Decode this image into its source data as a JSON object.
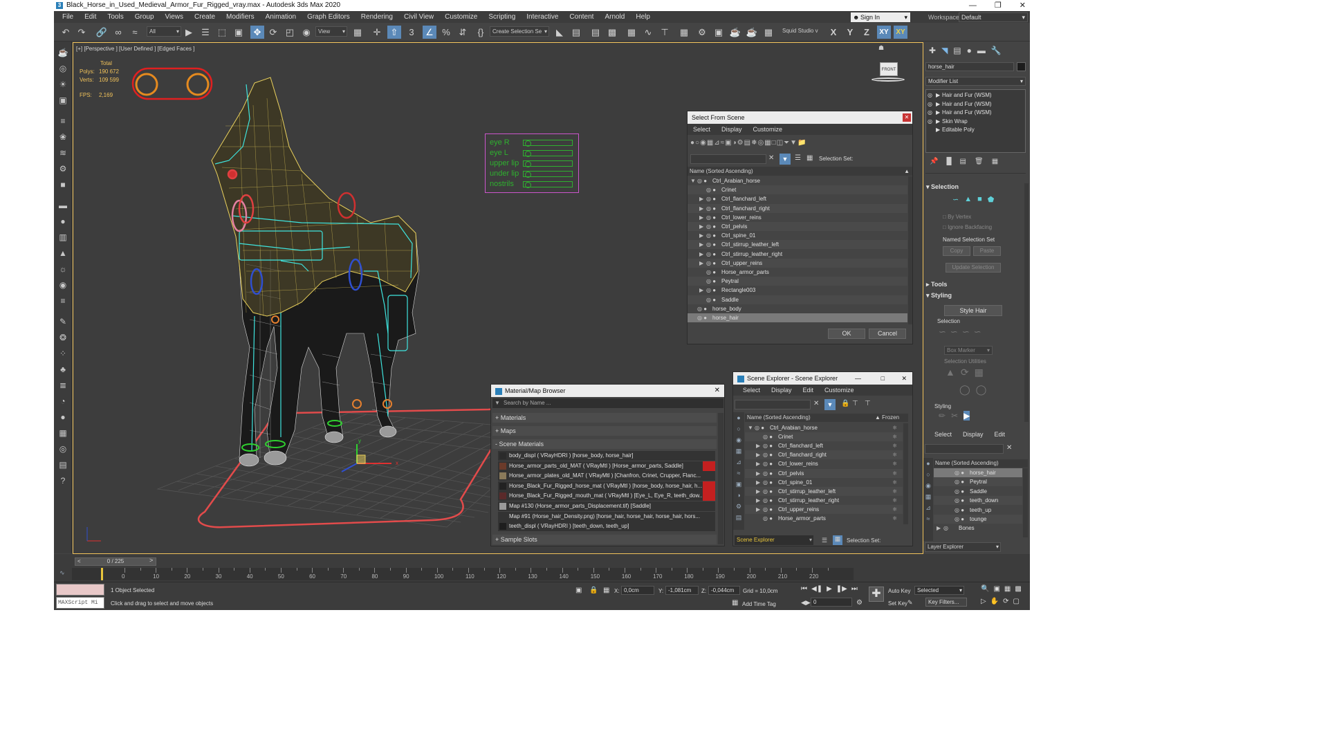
{
  "title": "Black_Horse_in_Used_Medieval_Armor_Fur_Rigged_vray.max - Autodesk 3ds Max 2020",
  "menu": [
    "File",
    "Edit",
    "Tools",
    "Group",
    "Views",
    "Create",
    "Modifiers",
    "Animation",
    "Graph Editors",
    "Rendering",
    "Civil View",
    "Customize",
    "Scripting",
    "Interactive",
    "Content",
    "Arnold",
    "Help"
  ],
  "signin": "Sign In",
  "workspace": {
    "label": "Workspaces:",
    "value": "Default"
  },
  "toolbar": {
    "filter": "All",
    "view": "View",
    "selection_set": "Create Selection Se",
    "squid": "Squid Studio v",
    "axes": [
      "X",
      "Y",
      "Z",
      "XY",
      "XY"
    ],
    "snap3": "3",
    "percent": "%"
  },
  "viewport": {
    "label": "[+] [Perspective ] [User Defined ] [Edged Faces ]",
    "stats": {
      "header": "Total",
      "polys_label": "Polys:",
      "polys": "190 672",
      "verts_label": "Verts:",
      "verts": "109 599",
      "fps_label": "FPS:",
      "fps": "2,169"
    },
    "rig_controls": [
      "eye R",
      "eye L",
      "upper lip",
      "under lip",
      "nostrils"
    ],
    "viewcube": "FRONT",
    "gizmo_axes": [
      "x",
      "y",
      "z"
    ]
  },
  "select_from_scene": {
    "title": "Select From Scene",
    "menu": [
      "Select",
      "Display",
      "Customize"
    ],
    "selection_set_label": "Selection Set:",
    "column": "Name (Sorted Ascending)",
    "rows": [
      {
        "name": "Ctrl_Arabian_horse",
        "level": 0,
        "expanded": true
      },
      {
        "name": "Crinet",
        "level": 1,
        "expanded": false,
        "leaf": true
      },
      {
        "name": "Ctrl_flanchard_left",
        "level": 1
      },
      {
        "name": "Ctrl_flanchard_right",
        "level": 1
      },
      {
        "name": "Ctrl_lower_reins",
        "level": 1
      },
      {
        "name": "Ctrl_pelvis",
        "level": 1
      },
      {
        "name": "Ctrl_spine_01",
        "level": 1
      },
      {
        "name": "Ctrl_stirrup_leather_left",
        "level": 1
      },
      {
        "name": "Ctrl_stirrup_leather_right",
        "level": 1
      },
      {
        "name": "Ctrl_upper_reins",
        "level": 1
      },
      {
        "name": "Horse_armor_parts",
        "level": 1,
        "leaf": true
      },
      {
        "name": "Peytral",
        "level": 1,
        "leaf": true
      },
      {
        "name": "Rectangle003",
        "level": 1
      },
      {
        "name": "Saddle",
        "level": 1,
        "leaf": true
      },
      {
        "name": "horse_body",
        "level": 0,
        "leaf": true
      },
      {
        "name": "horse_hair",
        "level": 0,
        "leaf": true,
        "selected": true
      }
    ],
    "ok": "OK",
    "cancel": "Cancel"
  },
  "material_browser": {
    "title": "Material/Map Browser",
    "search_placeholder": "Search by Name ...",
    "sections": [
      "+ Materials",
      "+ Maps",
      "- Scene Materials",
      "+ Sample Slots"
    ],
    "materials": [
      {
        "text": "body_displ ( VRayHDRI ) [horse_body, horse_hair]",
        "swatch": "#2b2b2b"
      },
      {
        "text": "Horse_armor_parts_old_MAT ( VRayMtl ) [Horse_armor_parts, Saddle]",
        "swatch": "#6b3b2a"
      },
      {
        "text": "Horse_armor_plates_old_MAT ( VRayMtl ) [Chanfron, Crinet, Crupper, Flanc...",
        "swatch": "#8a7a5a"
      },
      {
        "text": "Horse_Black_Fur_Rigged_horse_mat ( VRayMtl ) [horse_body, horse_hair, h...",
        "swatch": "#222222"
      },
      {
        "text": "Horse_Black_Fur_Rigged_mouth_mat ( VRayMtl ) [Eye_L, Eye_R, teeth_dow...",
        "swatch": "#5a2a2a"
      },
      {
        "text": "Map #130 (Horse_armor_parts_Displacement.tif) [Saddle]",
        "swatch": "#9a9a9a"
      },
      {
        "text": "Map #91 (Horse_hair_Density.png) [horse_hair, horse_hair, horse_hair, hors...",
        "swatch": "#333333"
      },
      {
        "text": "teeth_displ ( VRayHDRI ) [teeth_down, teeth_up]",
        "swatch": "#1e1e1e"
      }
    ]
  },
  "scene_explorer": {
    "title": "Scene Explorer - Scene Explorer",
    "menu": [
      "Select",
      "Display",
      "Edit",
      "Customize"
    ],
    "column": "Name (Sorted Ascending)",
    "frozen": "▲ Frozen",
    "rows": [
      "Ctrl_Arabian_horse",
      "Crinet",
      "Ctrl_flanchard_left",
      "Ctrl_flanchard_right",
      "Ctrl_lower_reins",
      "Ctrl_pelvis",
      "Ctrl_spine_01",
      "Ctrl_stirrup_leather_left",
      "Ctrl_stirrup_leather_right",
      "Ctrl_upper_reins",
      "Horse_armor_parts"
    ],
    "footer": "Scene Explorer",
    "selection_set_label": "Selection Set:"
  },
  "command_panel": {
    "object_name": "horse_hair",
    "modifier_list": "Modifier List",
    "stack": [
      "Hair and Fur (WSM)",
      "Hair and Fur (WSM)",
      "Hair and Fur (WSM)",
      "Skin Wrap",
      "Editable Poly"
    ],
    "selection_rollout": "Selection",
    "by_vertex": "By Vertex",
    "ignore_backfacing": "Ignore Backfacing",
    "named_selection_set": "Named Selection Set",
    "copy": "Copy",
    "paste": "Paste",
    "update_selection": "Update Selection",
    "tools_rollout": "Tools",
    "styling_rollout": "Styling",
    "style_hair": "Style Hair",
    "selection_label": "Selection",
    "box_marker": "Box Marker",
    "selection_utilities": "Selection Utilities",
    "styling_label": "Styling"
  },
  "layer_explorer": {
    "menu": [
      "Select",
      "Display",
      "Edit"
    ],
    "column": "Name (Sorted Ascending)",
    "rows": [
      "horse_hair",
      "Peytral",
      "Saddle",
      "teeth_down",
      "teeth_up",
      "tounge",
      "Bones"
    ],
    "footer": "Layer Explorer"
  },
  "timeline": {
    "frame": "0 / 225",
    "ticks": [
      "0",
      "10",
      "20",
      "30",
      "40",
      "50",
      "60",
      "70",
      "80",
      "90",
      "100",
      "110",
      "120",
      "130",
      "140",
      "150",
      "160",
      "170",
      "180",
      "190",
      "200",
      "210",
      "220"
    ]
  },
  "status": {
    "script_label": "MAXScript Mi",
    "selected": "1 Object Selected",
    "hint": "Click and drag to select and move objects",
    "x_label": "X:",
    "x": "0,0cm",
    "y_label": "Y:",
    "y": "-1,081cm",
    "z_label": "Z:",
    "z": "-0,044cm",
    "grid": "Grid = 10,0cm",
    "add_time_tag": "Add Time Tag",
    "auto_key": "Auto Key",
    "set_key": "Set Key",
    "selected_mode": "Selected",
    "key_filters": "Key Filters...",
    "frame_field": "0"
  }
}
